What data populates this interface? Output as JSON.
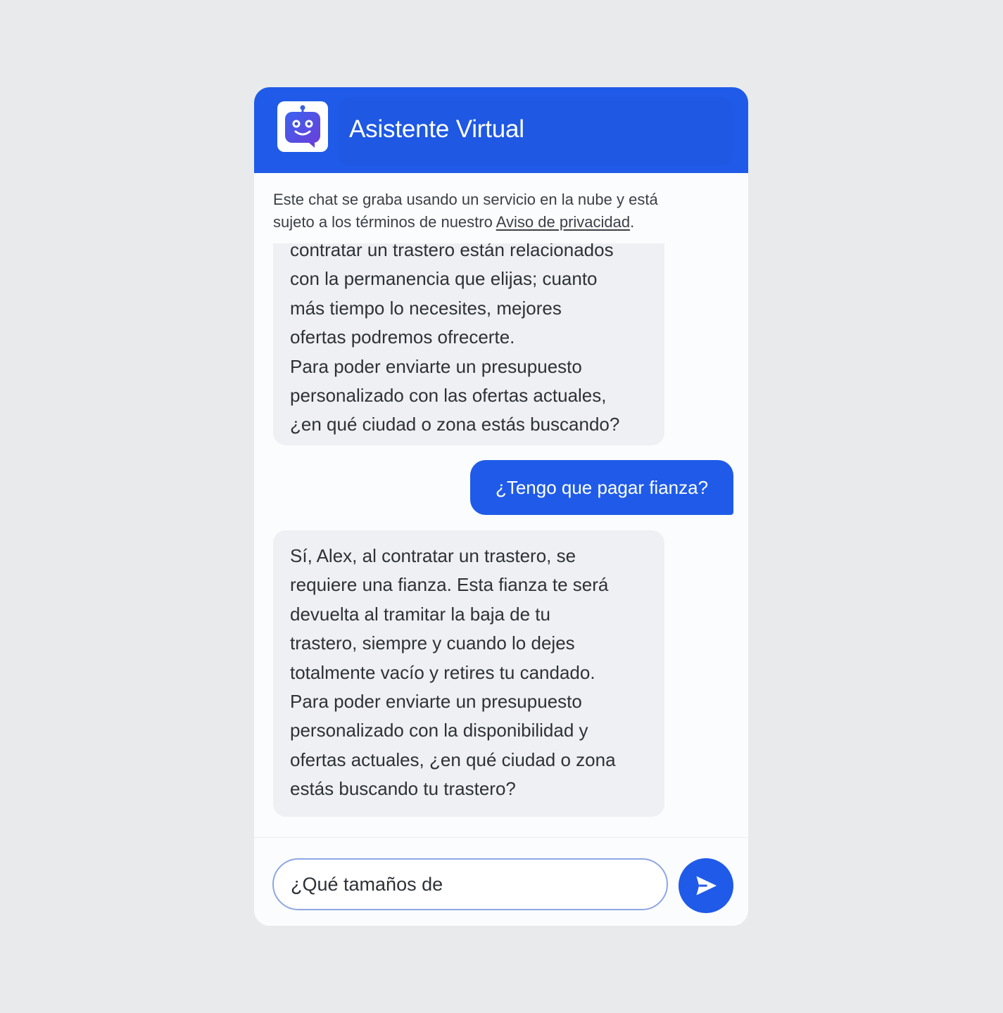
{
  "header": {
    "title": "Asistente Virtual",
    "avatar_icon": "robot-icon"
  },
  "privacy": {
    "text_line1": "Este chat se graba usando un servicio en la nube y está",
    "text_line2_prefix": "sujeto a los términos de nuestro ",
    "link_label": "Aviso de privacidad",
    "text_suffix": "."
  },
  "messages": [
    {
      "role": "bot",
      "lines": [
        "contratar un trastero están relacionados",
        "con la permanencia que elijas; cuanto",
        "más tiempo lo necesites, mejores",
        "ofertas podremos ofrecerte.",
        "Para poder enviarte un presupuesto",
        "personalizado con las ofertas actuales,",
        "¿en qué ciudad o zona estás buscando?"
      ]
    },
    {
      "role": "user",
      "text": "¿Tengo que pagar fianza?"
    },
    {
      "role": "bot",
      "lines": [
        "Sí, Alex, al contratar un trastero, se",
        "requiere una fianza. Esta fianza te será",
        "devuelta al tramitar la baja de tu",
        "trastero, siempre y cuando lo dejes",
        "totalmente vacío y retires tu candado.",
        "Para poder enviarte un presupuesto",
        "personalizado con la disponibilidad y",
        "ofertas actuales, ¿en qué ciudad o zona",
        "estás buscando tu trastero?"
      ]
    }
  ],
  "composer": {
    "value": "¿Qué tamaños de",
    "send_icon": "send-icon"
  },
  "colors": {
    "brand": "#1f5be8",
    "background": "#e9eaeb",
    "bot_bubble": "#eef0f3",
    "text": "#2e3136"
  }
}
